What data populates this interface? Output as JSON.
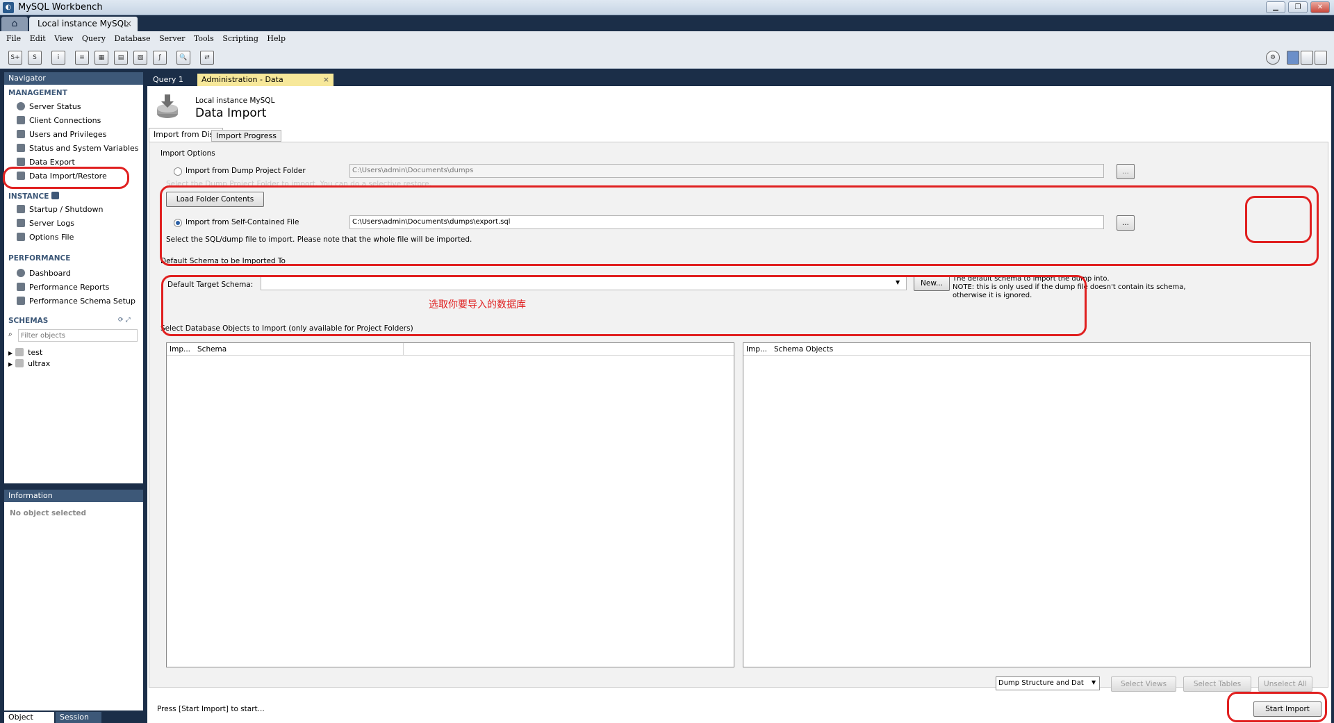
{
  "window": {
    "title": "MySQL Workbench",
    "app_icon": "mysql-dolphin-icon"
  },
  "tabs": {
    "home_icon": "home-icon",
    "connection": "Local instance MySQL",
    "close": "×"
  },
  "menu": [
    "File",
    "Edit",
    "View",
    "Query",
    "Database",
    "Server",
    "Tools",
    "Scripting",
    "Help"
  ],
  "navigator": {
    "title": "Navigator",
    "management_label": "MANAGEMENT",
    "management": [
      "Server Status",
      "Client Connections",
      "Users and Privileges",
      "Status and System Variables",
      "Data Export",
      "Data Import/Restore"
    ],
    "instance_label": "INSTANCE",
    "instance": [
      "Startup / Shutdown",
      "Server Logs",
      "Options File"
    ],
    "performance_label": "PERFORMANCE",
    "performance": [
      "Dashboard",
      "Performance Reports",
      "Performance Schema Setup"
    ],
    "schemas_label": "SCHEMAS",
    "filter_placeholder": "Filter objects",
    "schemas": [
      "test",
      "ultrax"
    ]
  },
  "information": {
    "title": "Information",
    "empty": "No object selected",
    "tab_object": "Object Info",
    "tab_session": "Session"
  },
  "doc_tabs": {
    "query": "Query 1",
    "admin": "Administration - Data Import/Res...",
    "close": "×"
  },
  "header": {
    "instance": "Local instance MySQL",
    "title": "Data Import"
  },
  "subtabs": {
    "disk": "Import from Disk",
    "progress": "Import Progress"
  },
  "options": {
    "group_label": "Import Options",
    "folder_radio": "Import from Dump Project Folder",
    "folder_path": "C:\\Users\\admin\\Documents\\dumps",
    "folder_hint": "Select the Dump Project Folder to import. You can do a selective restore.",
    "load_button": "Load Folder Contents",
    "file_radio": "Import from Self-Contained File",
    "file_path": "C:\\Users\\admin\\Documents\\dumps\\export.sql",
    "file_hint": "Select the SQL/dump file to import. Please note that the whole file will be imported.",
    "browse": "..."
  },
  "schema": {
    "group_label": "Default Schema to be Imported To",
    "target_label": "Default Target Schema:",
    "target_value": "",
    "new_button": "New...",
    "note1": "The default schema to import the dump into.",
    "note2": "NOTE: this is only used if the dump file doesn't contain its schema,",
    "note3": "otherwise it is ignored.",
    "annotation": "选取你要导入的数据库"
  },
  "objects": {
    "group_label": "Select Database Objects to Import (only available for Project Folders)",
    "left_col1": "Imp...",
    "left_col2": "Schema",
    "right_col1": "Imp...",
    "right_col2": "Schema Objects",
    "dump_select": "Dump Structure and Dat",
    "select_views": "Select Views",
    "select_tables": "Select Tables",
    "unselect_all": "Unselect All"
  },
  "footer": {
    "status": "Press [Start Import] to start...",
    "start": "Start Import"
  }
}
